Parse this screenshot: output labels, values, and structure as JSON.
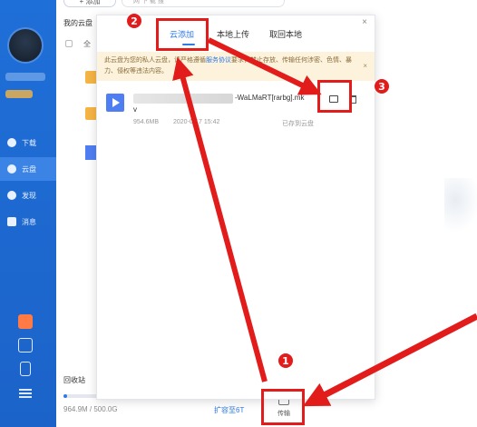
{
  "sidebar": {
    "items": [
      {
        "label": "下载",
        "icon": "download-icon"
      },
      {
        "label": "云盘",
        "icon": "cloud-icon"
      },
      {
        "label": "发现",
        "icon": "compass-icon"
      },
      {
        "label": "消息",
        "icon": "message-icon"
      }
    ],
    "bottom_icons": [
      "gift-icon",
      "tshirt-icon",
      "phone-icon",
      "menu-icon"
    ]
  },
  "toolbar": {
    "add_label": "+ 添加",
    "search_placeholder": "网 下 载 搜"
  },
  "main": {
    "breadcrumb": "我的云盘",
    "select_all": "全",
    "recycle_bin": "回收站",
    "storage_text": "964.9M / 500.0G",
    "storage_used_percent": 0.19,
    "expand_link": "扩容至6T",
    "transfer_label": "传输"
  },
  "popup": {
    "tabs": [
      "云添加",
      "本地上传",
      "取回本地"
    ],
    "active_tab": 0,
    "close": "×",
    "notice_text": "此云盘为您的私人云盘，请严格遵循",
    "notice_link": "服务协议",
    "notice_text2": "要求，禁止存放、传输任何涉密、色情、暴力、侵权等违法内容。",
    "notice_close": "×",
    "file": {
      "name_visible": "-WaLMaRT[rarbg].mk",
      "name_tail": "v",
      "size": "954.6MB",
      "date": "2020-0-17 15:42",
      "status": "已存到云盘"
    }
  },
  "annotations": {
    "badges": [
      "1",
      "2",
      "3"
    ],
    "color": "#e21b1b"
  }
}
